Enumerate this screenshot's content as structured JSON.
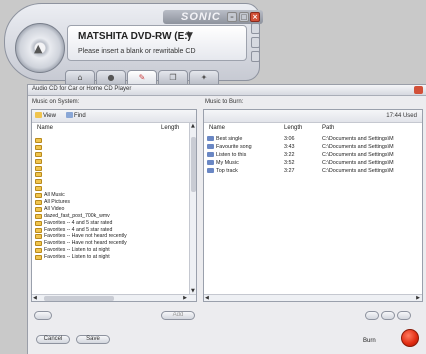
{
  "player": {
    "brand": "SONIC",
    "drive": "MATSHITA DVD-RW (E:)",
    "message": "Please insert a blank or rewritable CD",
    "tabs": [
      {
        "name": "tab-home",
        "icon": "house-icon",
        "glyph": "⌂"
      },
      {
        "name": "tab-burn",
        "icon": "disc-icon",
        "glyph": "●"
      },
      {
        "name": "tab-edit",
        "icon": "pencil-icon",
        "glyph": "✎"
      },
      {
        "name": "tab-copy",
        "icon": "copy-icon",
        "glyph": "❐"
      },
      {
        "name": "tab-tools",
        "icon": "tools-icon",
        "glyph": "✦"
      }
    ]
  },
  "window": {
    "title": "Audio CD for Car or Home CD Player",
    "left_pane_label": "Music on System:",
    "right_pane_label": "Music to Burn:",
    "toolbar": {
      "view": "View",
      "find": "Find"
    },
    "used": "17:44 Used",
    "left_columns": {
      "name": "Name",
      "length": "Length"
    },
    "right_columns": {
      "name": "Name",
      "length": "Length",
      "path": "Path"
    },
    "folders": [
      "",
      "",
      "",
      "",
      "",
      "",
      "",
      "",
      "All Music",
      "All Pictures",
      "All Video",
      "dazed_fast_post_700k_wmv",
      "Favorites -- 4 and 5 star rated",
      "Favorites -- 4 and 5 star rated",
      "Favorites -- Have not heard recently",
      "Favorites -- Have not heard recently",
      "Favorites -- Listen to at night",
      "Favorites -- Listen to at night"
    ],
    "tracks": [
      {
        "name": "Best single",
        "length": "3:06",
        "path": "C:\\Documents and Settings\\M"
      },
      {
        "name": "Favourite song",
        "length": "3:43",
        "path": "C:\\Documents and Settings\\M"
      },
      {
        "name": "Listen to this",
        "length": "3:22",
        "path": "C:\\Documents and Settings\\M"
      },
      {
        "name": "My Music",
        "length": "3:52",
        "path": "C:\\Documents and Settings\\M"
      },
      {
        "name": "Top track",
        "length": "3:27",
        "path": "C:\\Documents and Settings\\M"
      }
    ],
    "add_label": "Add",
    "cancel_label": "Cancel",
    "save_label": "Save",
    "burn_label": "Burn"
  },
  "colors": {
    "accent": "#e02a10",
    "folder": "#f0c44e",
    "track": "#6a87c4"
  }
}
